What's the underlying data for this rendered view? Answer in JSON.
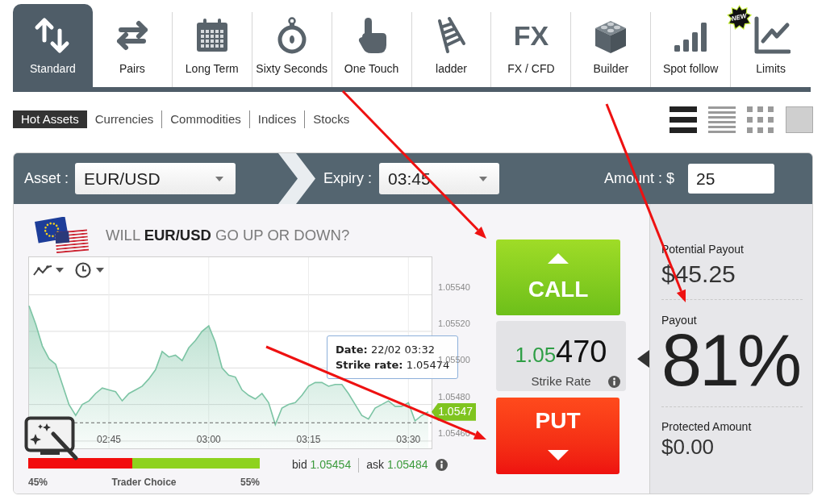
{
  "product_tabs": [
    {
      "label": "Standard",
      "selected": true
    },
    {
      "label": "Pairs",
      "selected": false
    },
    {
      "label": "Long Term",
      "selected": false
    },
    {
      "label": "Sixty Seconds",
      "selected": false
    },
    {
      "label": "One Touch",
      "selected": false
    },
    {
      "label": "ladder",
      "selected": false
    },
    {
      "label": "FX / CFD",
      "glyph": "FX",
      "selected": false
    },
    {
      "label": "Builder",
      "selected": false
    },
    {
      "label": "Spot follow",
      "selected": false
    },
    {
      "label": "Limits",
      "badge": "NEW",
      "selected": false
    }
  ],
  "asset_categories": [
    {
      "label": "Hot Assets",
      "selected": true
    },
    {
      "label": "Currencies",
      "selected": false
    },
    {
      "label": "Commodities",
      "selected": false
    },
    {
      "label": "Indices",
      "selected": false
    },
    {
      "label": "Stocks",
      "selected": false
    }
  ],
  "view_modes": [
    {
      "kind": "thick-list",
      "selected": true
    },
    {
      "kind": "thin-list",
      "selected": false
    },
    {
      "kind": "grid",
      "selected": false
    },
    {
      "kind": "tile",
      "selected": false
    }
  ],
  "trade_bar": {
    "asset_label": "Asset :",
    "asset": "EUR/USD",
    "expiry_label": "Expiry :",
    "expiry": "03:45",
    "amount_label": "Amount : $",
    "amount": "25"
  },
  "question": "WILL **EUR/USD** GO UP OR DOWN?",
  "chart": {
    "chart_data": {
      "type": "area",
      "categories": [
        null,
        null,
        null,
        null,
        null,
        null,
        null,
        null,
        null,
        null,
        null,
        null,
        "02:45",
        null,
        null,
        null,
        null,
        null,
        null,
        null,
        null,
        null,
        null,
        null,
        null,
        null,
        null,
        "03:00",
        null,
        null,
        null,
        null,
        null,
        null,
        null,
        null,
        null,
        null,
        null,
        null,
        null,
        null,
        "03:15",
        null,
        null,
        null,
        null,
        null,
        null,
        null,
        null,
        null,
        null,
        null,
        null,
        null,
        null,
        "03:30",
        null,
        null,
        null
      ],
      "series": [
        {
          "color": "#7cc4a4",
          "values": [
            1.05534,
            1.05524,
            1.05512,
            1.05505,
            1.05502,
            1.05491,
            1.0548,
            1.05474,
            1.0548,
            1.05482,
            1.05486,
            1.05489,
            1.05488,
            1.05487,
            1.05482,
            1.05486,
            1.05488,
            1.0549,
            1.05494,
            1.05499,
            1.05509,
            1.05506,
            1.05507,
            1.05504,
            1.05511,
            1.05515,
            1.0552,
            1.05523,
            1.05514,
            1.055,
            1.05496,
            1.05495,
            1.05488,
            1.05485,
            1.05483,
            1.05486,
            1.05481,
            1.05469,
            1.05478,
            1.0548,
            1.05481,
            1.05485,
            1.0549,
            1.05492,
            1.05492,
            1.0549,
            1.05491,
            1.05491,
            1.05486,
            1.0548,
            1.05474,
            1.05472,
            1.05478,
            1.0548,
            1.05482,
            1.05479,
            1.05479,
            1.05481,
            1.05471,
            1.05474,
            1.05476
          ]
        }
      ],
      "ylim": [
        1.05456,
        1.05561
      ],
      "yticks": [
        {
          "value": 1.0554,
          "label": "1.05540"
        },
        {
          "value": 1.0552,
          "label": "1.05520"
        },
        {
          "value": 1.055,
          "label": "1.05500"
        },
        {
          "value": 1.0548,
          "label": "1.05480"
        },
        {
          "value": 1.0546,
          "label": "1.05460"
        }
      ],
      "grid": true,
      "ref_lines": [
        {
          "axis": "y",
          "value": 1.0547
        }
      ]
    },
    "tooltip": [
      "**Date:** 22/02 03:32",
      "**Strike rate:** 1.05474"
    ],
    "price_tag": "1.0547"
  },
  "trader_choice": {
    "level": 0.45,
    "left_label": "45%",
    "title": "Trader Choice",
    "right_label": "55%"
  },
  "quotes": {
    "bid_label": "bid",
    "bid": "1.05454",
    "ask_label": "ask",
    "ask": "1.05484"
  },
  "call_button": {
    "label": "CALL"
  },
  "strike": {
    "prefix": "1.05",
    "digits": "470",
    "label": "Strike Rate"
  },
  "put_button": {
    "label": "PUT"
  },
  "summary": {
    "potential_payout_label": "Potential Payout",
    "potential_payout": "$45.25",
    "payout_label": "Payout",
    "payout": "81%",
    "protected_label": "Protected Amount",
    "protected": "$0.00"
  }
}
